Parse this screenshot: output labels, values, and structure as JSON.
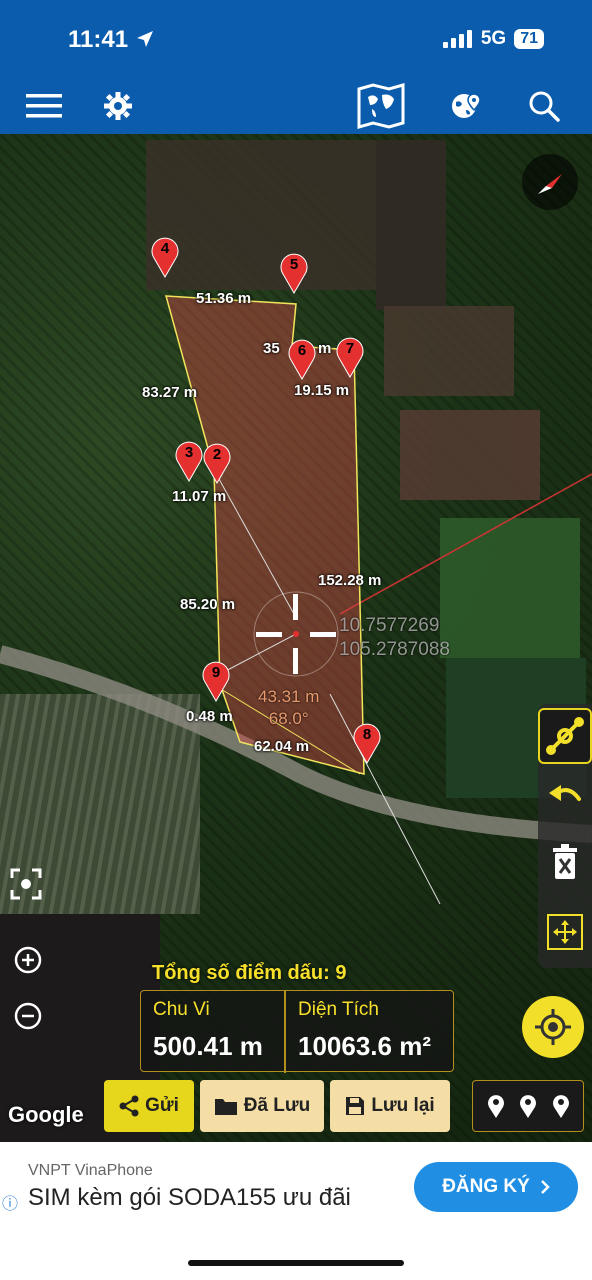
{
  "status_bar": {
    "time": "11:41",
    "network": "5G",
    "battery": "71"
  },
  "toolbar": {
    "menu_icon": "hamburger-menu-icon",
    "settings_icon": "gear-icon",
    "map_icon": "world-map-icon",
    "globe_icon": "globe-pin-icon",
    "search_icon": "search-icon"
  },
  "map": {
    "points": [
      {
        "label": "4"
      },
      {
        "label": "5"
      },
      {
        "label": "6"
      },
      {
        "label": "7"
      },
      {
        "label": "3"
      },
      {
        "label": "2"
      },
      {
        "label": "9"
      },
      {
        "label": "8"
      }
    ],
    "measurements": [
      {
        "text": "51.36 m"
      },
      {
        "text": "35"
      },
      {
        "text": "m"
      },
      {
        "text": "19.15 m"
      },
      {
        "text": "83.27 m"
      },
      {
        "text": "11.07 m"
      },
      {
        "text": "152.28 m"
      },
      {
        "text": "85.20 m"
      },
      {
        "text": "0.48 m"
      },
      {
        "text": "62.04 m"
      }
    ],
    "coordinates": {
      "lat": "10.7577269",
      "lng": "105.2787088"
    },
    "current_segment": {
      "length": "43.31 m",
      "angle": "68.0°"
    },
    "attribution": "Google"
  },
  "colors": {
    "accent_blue": "#0c5cad",
    "yellow": "#e7d71c",
    "polygon_fill": "#d94848",
    "pin_red": "#e53030"
  },
  "summary": {
    "points_count_label": "Tổng số điểm dấu: 9",
    "perimeter_label": "Chu Vi",
    "perimeter_value": "500.41 m",
    "area_label": "Diện Tích",
    "area_value": "10063.6 m²"
  },
  "actions": {
    "send": "Gửi",
    "saved": "Đã Lưu",
    "save": "Lưu lại"
  },
  "ad": {
    "brand": "VNPT VinaPhone",
    "text": "SIM kèm gói SODA155 ưu đãi",
    "cta": "ĐĂNG KÝ"
  }
}
